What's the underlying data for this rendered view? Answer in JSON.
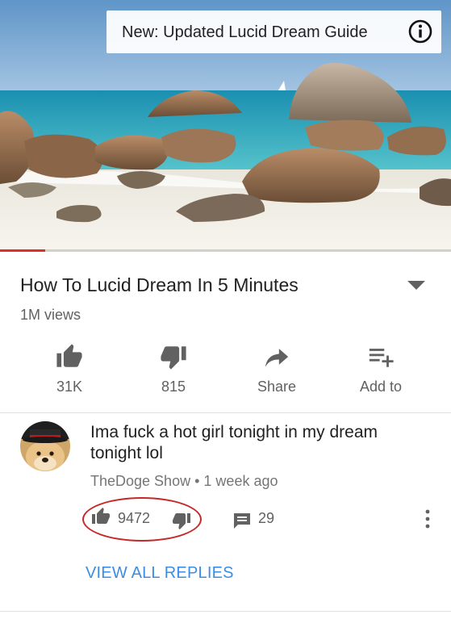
{
  "video": {
    "card_text": "New: Updated Lucid Dream Guide",
    "info_icon": "info-circle-icon",
    "progress_fraction": 0.1,
    "progress_color": "#e52d27"
  },
  "details": {
    "title": "How To Lucid Dream In 5 Minutes",
    "views": "1M views",
    "expand_icon": "chevron-down-icon"
  },
  "actions": [
    {
      "label": "31K",
      "icon": "thumbs-up-icon"
    },
    {
      "label": "815",
      "icon": "thumbs-down-icon"
    },
    {
      "label": "Share",
      "icon": "share-icon"
    },
    {
      "label": "Add to",
      "icon": "playlist-add-icon"
    }
  ],
  "comment": {
    "text": "Ima fuck a hot girl tonight in my dream tonight lol",
    "author": "TheDoge Show",
    "separator": "•",
    "time": "1 week ago",
    "likes": "9472",
    "replies": "29",
    "view_replies": "VIEW ALL REPLIES"
  },
  "colors": {
    "accent_link": "#3b8de6",
    "highlight_ring": "#c62828"
  }
}
